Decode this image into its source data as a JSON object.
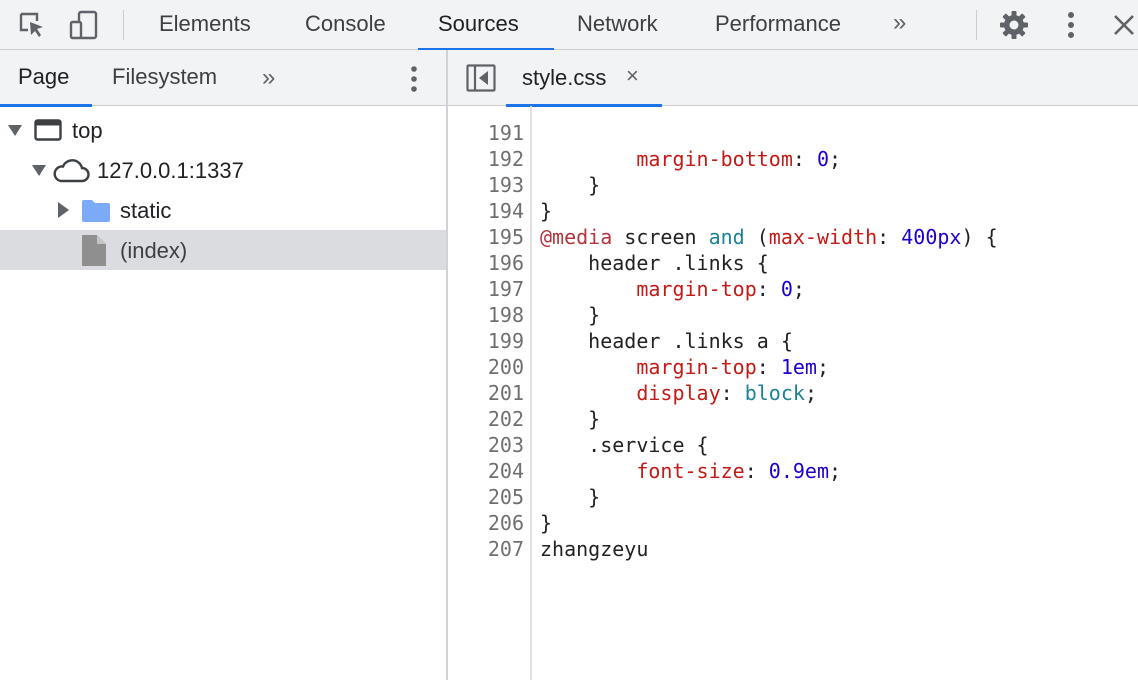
{
  "toolbar": {
    "tabs": [
      "Elements",
      "Console",
      "Sources",
      "Network",
      "Performance"
    ],
    "active_tab": "Sources",
    "more_tabs": "»"
  },
  "navigator": {
    "tabs": [
      "Page",
      "Filesystem"
    ],
    "active_tab": "Page",
    "more_tabs": "»",
    "tree": {
      "frame": "top",
      "origin": "127.0.0.1:1337",
      "folder": "static",
      "file": "(index)"
    }
  },
  "editor": {
    "open_file": "style.css",
    "close_glyph": "×",
    "lines": [
      {
        "n": "191",
        "text": "        margin-bottom: 0;"
      },
      {
        "n": "192",
        "text": "    }"
      },
      {
        "n": "193",
        "text": "}"
      },
      {
        "n": "194",
        "text": "@media screen and (max-width: 400px) {"
      },
      {
        "n": "195",
        "text": "    header .links {"
      },
      {
        "n": "196",
        "text": "        margin-top: 0;"
      },
      {
        "n": "197",
        "text": "    }"
      },
      {
        "n": "198",
        "text": "    header .links a {"
      },
      {
        "n": "199",
        "text": "        margin-top: 1em;"
      },
      {
        "n": "200",
        "text": "        display: block;"
      },
      {
        "n": "201",
        "text": "    }"
      },
      {
        "n": "202",
        "text": "    .service {"
      },
      {
        "n": "203",
        "text": "        font-size: 0.9em;"
      },
      {
        "n": "204",
        "text": "    }"
      },
      {
        "n": "205",
        "text": "}"
      },
      {
        "n": "206",
        "text": "zhangzeyu"
      },
      {
        "n": "207",
        "text": ""
      }
    ]
  },
  "colors": {
    "accent": "#1a73e8",
    "toolbar_bg": "#f1f3f4",
    "selected_row": "#dadce0",
    "folder": "#7baaf7",
    "css_property": "#c41a16",
    "css_number": "#1c00cf",
    "css_keyword": "#1c8295"
  }
}
